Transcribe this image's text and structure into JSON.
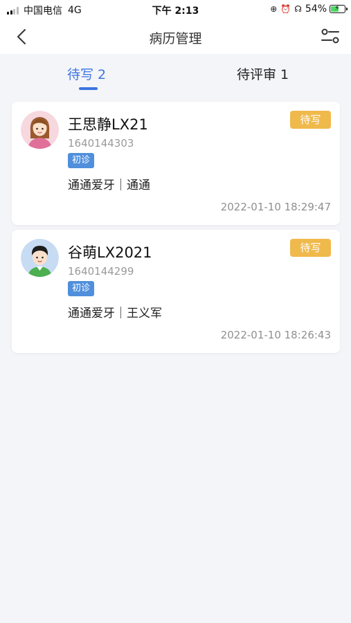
{
  "status_bar": {
    "carrier": "中国电信",
    "network": "4G",
    "time": "下午 2:13",
    "battery": "54%",
    "battery_level": 0.54,
    "icons": [
      "signal-icon",
      "lock-rotation-icon",
      "alarm-icon",
      "headphones-icon",
      "battery-charging-icon"
    ]
  },
  "nav": {
    "title": "病历管理",
    "back_icon": "chevron-left-icon",
    "filter_icon": "filter-sliders-icon"
  },
  "tabs": [
    {
      "label": "待写 2",
      "active": true
    },
    {
      "label": "待评审 1",
      "active": false
    }
  ],
  "colors": {
    "accent": "#3b74e0",
    "badge_pending": "#f0b94b",
    "tag_first_visit": "#4f8fdc",
    "background": "#f4f5f9"
  },
  "records": [
    {
      "name": "王思静LX21",
      "id": "1640144303",
      "tag": "初诊",
      "clinic_doctor": "通通爱牙｜通通",
      "status": "待写",
      "time": "2022-01-10 18:29:47",
      "avatar": "female-avatar-icon"
    },
    {
      "name": "谷萌LX2021",
      "id": "1640144299",
      "tag": "初诊",
      "clinic_doctor": "通通爱牙｜王义军",
      "status": "待写",
      "time": "2022-01-10 18:26:43",
      "avatar": "male-avatar-icon"
    }
  ]
}
